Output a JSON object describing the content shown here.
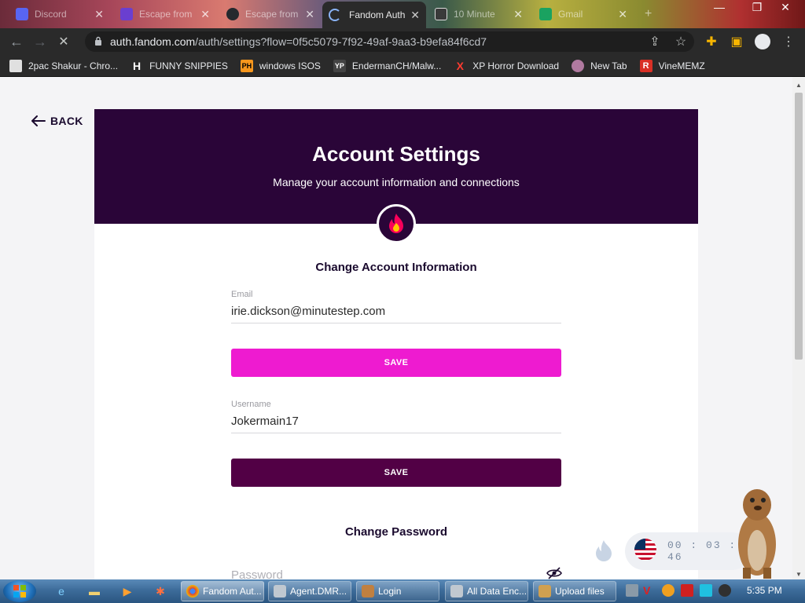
{
  "browser": {
    "tabs": [
      {
        "label": "Discord",
        "color": "#5865f2"
      },
      {
        "label": "Escape from",
        "color": "#6a3fd0"
      },
      {
        "label": "Escape from",
        "color": "#24292e"
      },
      {
        "label": "Fandom Auth",
        "color": "#8ab4f8"
      },
      {
        "label": "10 Minute",
        "color": "#3a3a3a"
      },
      {
        "label": "Gmail",
        "color": "#1aa260"
      }
    ],
    "new_tab_symbol": "+",
    "url_host": "auth.fandom.com",
    "url_path": "/auth/settings?flow=0f5c5079-7f92-49af-9aa3-b9efa84f6cd7",
    "bookmarks": [
      {
        "label": "2pac Shakur - Chro...",
        "icon_text": "",
        "icon_color": "#e0e0e0"
      },
      {
        "label": "FUNNY SNIPPIES",
        "icon_text": "H",
        "icon_color": "#ffffff"
      },
      {
        "label": "windows ISOS",
        "icon_text": "PH",
        "icon_color": "#f7971d"
      },
      {
        "label": "EndermanCH/Malw...",
        "icon_text": "YP",
        "icon_color": "#444444"
      },
      {
        "label": "XP Horror Download",
        "icon_text": "X",
        "icon_color": "#ff3b30"
      },
      {
        "label": "New Tab",
        "icon_text": "",
        "icon_color": "#b07aa0"
      },
      {
        "label": "VineMEMZ",
        "icon_text": "R",
        "icon_color": "#d93025"
      }
    ]
  },
  "page": {
    "back_label": "BACK",
    "hero_title": "Account Settings",
    "hero_subtitle": "Manage your account information and connections",
    "section_account": "Change Account Information",
    "email_label": "Email",
    "email_value": "irie.dickson@minutestep.com",
    "save_label": "SAVE",
    "username_label": "Username",
    "username_value": "Jokermain17",
    "section_password": "Change Password",
    "password_placeholder": "Password"
  },
  "colors": {
    "brand_dark": "#2a0538",
    "save_pink": "#ee1bd0",
    "save_dark": "#520045"
  },
  "timer": {
    "hours": "00",
    "minutes": "03",
    "seconds": "46"
  },
  "taskbar": {
    "tasks": [
      {
        "label": "Fandom Aut...",
        "icon_color": "#4285f4"
      },
      {
        "label": "Agent.DMR...",
        "icon_color": "#c0c8d0"
      },
      {
        "label": "Login",
        "icon_color": "#c08040"
      },
      {
        "label": "All Data Enc...",
        "icon_color": "#c0c8d0"
      },
      {
        "label": "Upload files",
        "icon_color": "#d0a050"
      }
    ],
    "clock": "5:35 PM"
  }
}
